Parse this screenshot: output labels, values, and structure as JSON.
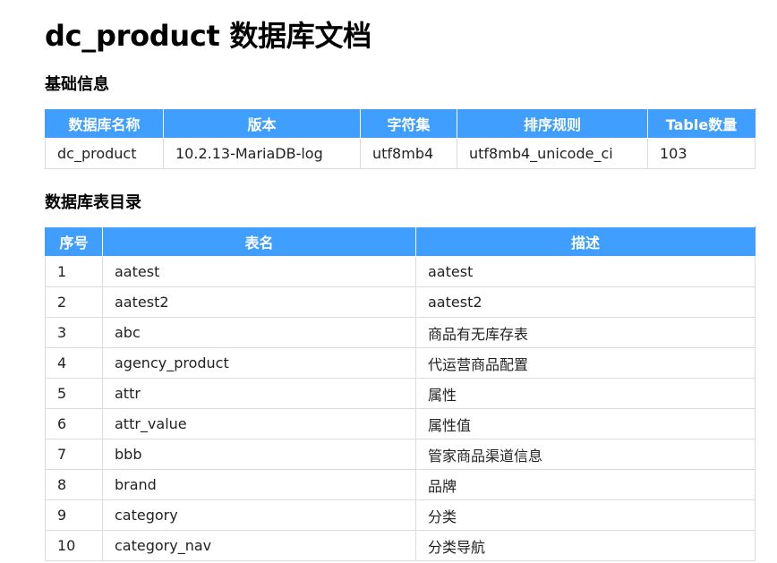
{
  "title": "dc_product 数据库文档",
  "basic_info": {
    "heading": "基础信息",
    "columns": [
      "数据库名称",
      "版本",
      "字符集",
      "排序规则",
      "Table数量"
    ],
    "row": [
      "dc_product",
      "10.2.13-MariaDB-log",
      "utf8mb4",
      "utf8mb4_unicode_ci",
      "103"
    ]
  },
  "table_directory": {
    "heading": "数据库表目录",
    "columns": [
      "序号",
      "表名",
      "描述"
    ],
    "rows": [
      [
        "1",
        "aatest",
        "aatest"
      ],
      [
        "2",
        "aatest2",
        "aatest2"
      ],
      [
        "3",
        "abc",
        "商品有无库存表"
      ],
      [
        "4",
        "agency_product",
        "代运营商品配置"
      ],
      [
        "5",
        "attr",
        "属性"
      ],
      [
        "6",
        "attr_value",
        "属性值"
      ],
      [
        "7",
        "bbb",
        "管家商品渠道信息"
      ],
      [
        "8",
        "brand",
        "品牌"
      ],
      [
        "9",
        "category",
        "分类"
      ],
      [
        "10",
        "category_nav",
        "分类导航"
      ]
    ]
  }
}
